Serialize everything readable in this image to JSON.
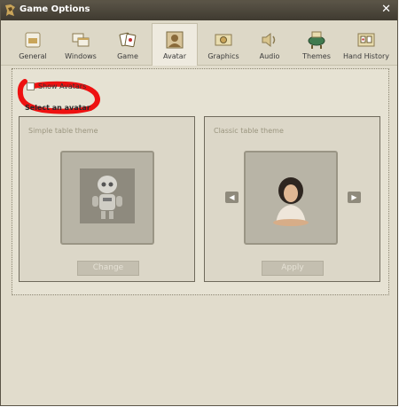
{
  "window": {
    "title": "Game Options"
  },
  "tabs": [
    {
      "label": "General",
      "icon": "general-icon"
    },
    {
      "label": "Windows",
      "icon": "windows-icon"
    },
    {
      "label": "Game",
      "icon": "cards-icon"
    },
    {
      "label": "Avatar",
      "icon": "avatar-icon",
      "active": true
    },
    {
      "label": "Graphics",
      "icon": "graphics-icon"
    },
    {
      "label": "Audio",
      "icon": "speaker-icon"
    },
    {
      "label": "Themes",
      "icon": "table-icon"
    },
    {
      "label": "Hand History",
      "icon": "hand-history-icon"
    }
  ],
  "avatar": {
    "show_avatars_label": "Show Avatars",
    "show_avatars_checked": false,
    "select_label": "Select an avatar",
    "simple": {
      "title": "Simple table theme",
      "button": "Change"
    },
    "classic": {
      "title": "Classic table theme",
      "button": "Apply"
    }
  },
  "colors": {
    "accent_red": "#ee1111",
    "titlebar": "#4a4539",
    "background": "#e1dccc"
  }
}
